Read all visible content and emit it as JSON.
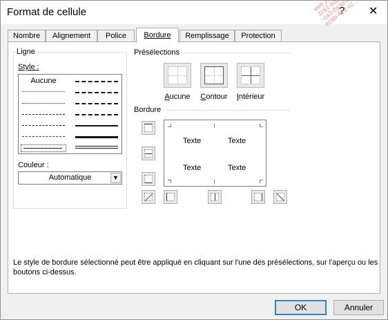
{
  "window": {
    "title": "Format de cellule",
    "help_glyph": "?",
    "close_glyph": "✕",
    "watermark_lines": [
      "ee6 16ae8e",
      "1c61-8da3-efdd3b",
      "-ca3-0a3d-d6cb-47e",
      "ec6b-4e2-v2...7e7a"
    ]
  },
  "tabs": [
    {
      "label": "Nombre",
      "active": false
    },
    {
      "label": "Alignement",
      "active": false
    },
    {
      "label": "Police",
      "active": false
    },
    {
      "label": "Bordure",
      "active": true
    },
    {
      "label": "Remplissage",
      "active": false
    },
    {
      "label": "Protection",
      "active": false
    }
  ],
  "ligne": {
    "group_title": "Ligne",
    "style_label": "Style :",
    "none_label": "Aucune",
    "color_label": "Couleur :",
    "color_value": "Automatique"
  },
  "presets": {
    "group_title": "Présélections",
    "items": [
      {
        "label": "Aucune",
        "underline_char": "A"
      },
      {
        "label": "Contour",
        "underline_char": "C"
      },
      {
        "label": "Intérieur",
        "underline_char": "I"
      }
    ]
  },
  "border": {
    "group_title": "Bordure",
    "preview_text": [
      "Texte",
      "Texte",
      "Texte",
      "Texte"
    ]
  },
  "description": "Le style de bordure sélectionné peut être appliqué en cliquant sur l'une des présélections, sur l'aperçu ou les boutons ci-dessus.",
  "buttons": {
    "ok": "OK",
    "cancel": "Annuler"
  },
  "colors": {
    "accent": "#3c7fb1",
    "dialog_bg": "#f0f0f0"
  }
}
